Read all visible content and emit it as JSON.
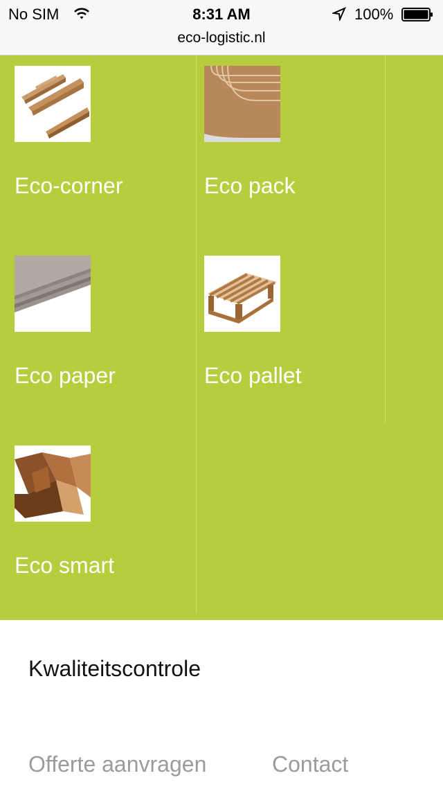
{
  "status": {
    "carrier": "No SIM",
    "time": "8:31 AM",
    "battery": "100%",
    "url": "eco-logistic.nl"
  },
  "products": [
    {
      "name": "Eco-corner",
      "icon": "cardboard-corner-image"
    },
    {
      "name": "Eco pack",
      "icon": "cardboard-sheets-image"
    },
    {
      "name": "Eco paper",
      "icon": "grey-board-image"
    },
    {
      "name": "Eco pallet",
      "icon": "cardboard-pallet-image"
    },
    {
      "name": "Eco smart",
      "icon": "corner-profiles-image"
    }
  ],
  "menu": {
    "quality": "Kwaliteitscontrole",
    "quote": "Offerte aanvragen",
    "contact": "Contact"
  },
  "colors": {
    "grid_green": "#b8cd3e",
    "menu_text": "#111111",
    "menu_muted": "#9b9b9b"
  }
}
